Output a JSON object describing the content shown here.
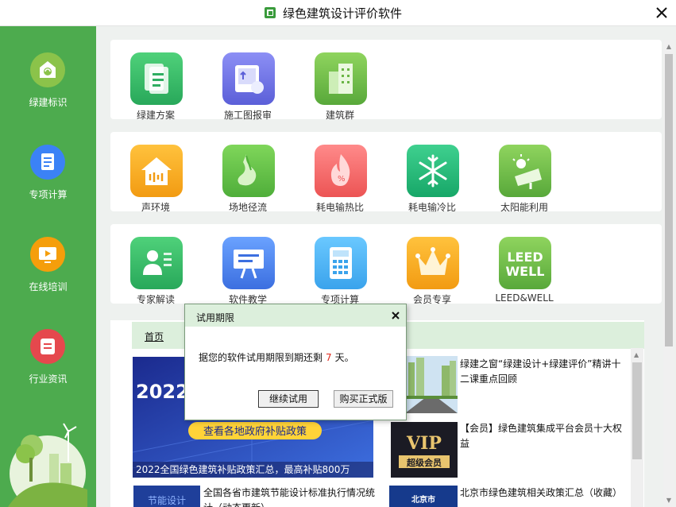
{
  "window": {
    "title": "绿色建筑设计评价软件"
  },
  "sidebar": {
    "items": [
      {
        "label": "绿建标识",
        "icon": "building-badge-icon",
        "color": "#8bc34a"
      },
      {
        "label": "专项计算",
        "icon": "document-icon",
        "color": "#3b82f6"
      },
      {
        "label": "在线培训",
        "icon": "video-play-icon",
        "color": "#f59e0b"
      },
      {
        "label": "行业资讯",
        "icon": "news-icon",
        "color": "#e5484d"
      }
    ]
  },
  "groups": [
    {
      "tiles": [
        {
          "label": "绿建方案",
          "icon": "scheme-doc-icon"
        },
        {
          "label": "施工图报审",
          "icon": "blueprint-icon"
        },
        {
          "label": "建筑群",
          "icon": "buildings-icon"
        }
      ]
    },
    {
      "tiles": [
        {
          "label": "声环境",
          "icon": "sound-house-icon"
        },
        {
          "label": "场地径流",
          "icon": "runoff-icon"
        },
        {
          "label": "耗电输热比",
          "icon": "flame-icon"
        },
        {
          "label": "耗电输冷比",
          "icon": "snowflake-icon"
        },
        {
          "label": "太阳能利用",
          "icon": "solar-panel-icon"
        }
      ]
    },
    {
      "tiles": [
        {
          "label": "专家解读",
          "icon": "expert-icon"
        },
        {
          "label": "软件教学",
          "icon": "teaching-icon"
        },
        {
          "label": "专项计算",
          "icon": "calculator-icon"
        },
        {
          "label": "会员专享",
          "icon": "crown-icon"
        },
        {
          "label": "LEED&WELL",
          "icon": "leed-well-icon",
          "icon_text": [
            "LEED",
            "WELL"
          ]
        }
      ]
    }
  ],
  "news": {
    "tab": "首页",
    "banner": {
      "year_text": "2022",
      "ribbon": "查看各地政府补贴政策",
      "caption": "2022全国绿色建筑补贴政策汇总，最高补贴800万"
    },
    "items": [
      {
        "title": "绿建之窗“绿建设计+绿建评价”精讲十二课重点回顾",
        "thumb": "street-photo"
      },
      {
        "title": "【会员】绿色建筑集成平台会员十大权益",
        "thumb": "vip",
        "thumb_text": [
          "VIP",
          "超级会员"
        ]
      },
      {
        "title": "全国各省市建筑节能设计标准执行情况统计（动态更新）",
        "thumb": "energy",
        "thumb_text": "节能设计"
      },
      {
        "title": "北京市绿色建筑相关政策汇总（收藏）",
        "thumb": "beijing",
        "thumb_text": "北京市"
      }
    ]
  },
  "dialog": {
    "title": "试用期限",
    "message_prefix": "据您的软件试用期限到期还剩",
    "days": "7",
    "message_suffix": "天。",
    "continue_label": "继续试用",
    "buy_label": "购买正式版"
  }
}
